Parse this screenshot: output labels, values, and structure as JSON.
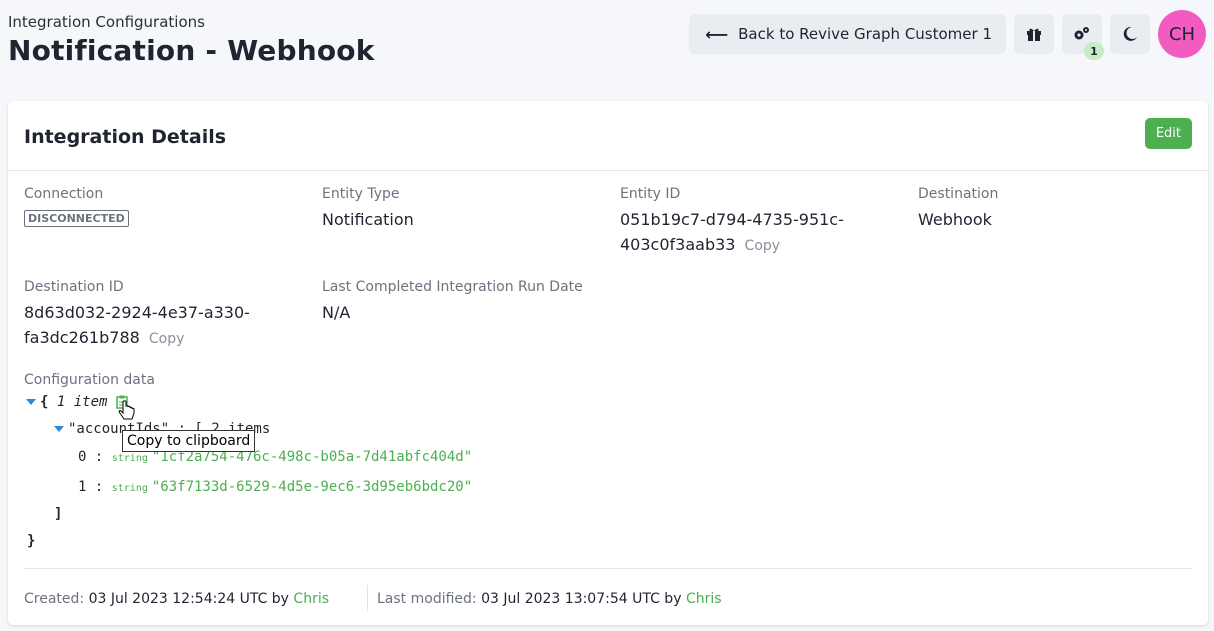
{
  "header": {
    "breadcrumb": "Integration Configurations",
    "title": "Notification - Webhook",
    "back_label": "Back to Revive Graph Customer 1",
    "settings_badge": "1",
    "avatar_initials": "CH",
    "avatar_color": "#f25cc1"
  },
  "card": {
    "title": "Integration Details",
    "edit_label": "Edit",
    "fields": {
      "connection_label": "Connection",
      "connection_value": "DISCONNECTED",
      "entity_type_label": "Entity Type",
      "entity_type_value": "Notification",
      "entity_id_label": "Entity ID",
      "entity_id_line1": "051b19c7-d794-4735-951c-",
      "entity_id_line2": "403c0f3aab33",
      "destination_label": "Destination",
      "destination_value": "Webhook",
      "destination_id_label": "Destination ID",
      "destination_id_line1": "8d63d032-2924-4e37-a330-",
      "destination_id_line2": "fa3dc261b788",
      "last_run_label": "Last Completed Integration Run Date",
      "last_run_value": "N/A",
      "copy_label": "Copy"
    },
    "config": {
      "label": "Configuration data",
      "root_open": "{",
      "root_meta": "1 item",
      "key_line": "\"accountIds\" : [ 2 items",
      "items": [
        {
          "index": "0 :",
          "type": "string",
          "value": "\"1cf2a754-476c-498c-b05a-7d41abfc404d\""
        },
        {
          "index": "1 :",
          "type": "string",
          "value": "\"63f7133d-6529-4d5e-9ec6-3d95eb6bdc20\""
        }
      ],
      "array_close": "]",
      "root_close": "}",
      "tooltip": "Copy to clipboard"
    },
    "footer": {
      "created_label": "Created:",
      "created_value": "03 Jul 2023 12:54:24 UTC by",
      "created_user": "Chris",
      "modified_label": "Last modified:",
      "modified_value": "03 Jul 2023 13:07:54 UTC by",
      "modified_user": "Chris"
    }
  },
  "colors": {
    "accent_green": "#4caf50",
    "caret_blue": "#2b88d8"
  }
}
